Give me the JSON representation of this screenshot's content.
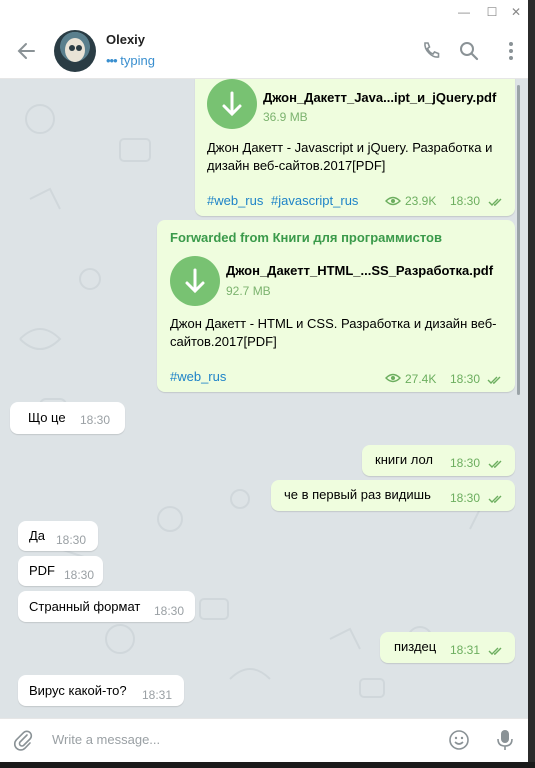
{
  "window": {
    "controls": [
      "—",
      "☐",
      "✕"
    ]
  },
  "header": {
    "name": "Olexiy",
    "status": "typing"
  },
  "messages": [
    {
      "file_name": "Джон_Дакетт_Java...ipt_и_jQuery.pdf",
      "file_size": "36.9 MB",
      "desc_line1": "Джон Дакетт -  Javascript и jQuery. Разработка и",
      "desc_line2": "дизайн веб-сайтов.2017[PDF]",
      "tag1": "#web_rus",
      "tag2": "#javascript_rus",
      "views": "23.9K",
      "time": "18:30"
    },
    {
      "forwarded": "Forwarded from Книги для программистов",
      "file_name": "Джон_Дакетт_HTML_...SS_Разработка.pdf",
      "file_size": "92.7 MB",
      "desc_line1": "Джон Дакетт -  HTML и CSS. Разработка и дизайн веб-",
      "desc_line2": "сайтов.2017[PDF]",
      "tag1": "#web_rus",
      "views": "27.4K",
      "time": "18:30"
    },
    {
      "text": "Що це",
      "time": "18:30"
    },
    {
      "text": "книги лол",
      "time": "18:30"
    },
    {
      "text": "че в первый раз видишь",
      "time": "18:30"
    },
    {
      "text": "Да",
      "time": "18:30"
    },
    {
      "text": "PDF",
      "time": "18:30"
    },
    {
      "text": "Странный формат",
      "time": "18:30"
    },
    {
      "text": "пиздец",
      "time": "18:31"
    },
    {
      "text": "Вирус какой-то?",
      "time": "18:31"
    }
  ],
  "input": {
    "placeholder": "Write a message..."
  },
  "colors": {
    "out_bubble": "#effdde",
    "in_bubble": "#ffffff",
    "accent_green": "#78c272",
    "link": "#1e83c8",
    "chat_bg": "#dde3e6"
  },
  "icons": [
    "back-arrow-icon",
    "phone-icon",
    "search-icon",
    "more-vertical-icon",
    "download-icon",
    "eye-icon",
    "double-check-icon",
    "attach-icon",
    "emoji-icon",
    "microphone-icon"
  ]
}
